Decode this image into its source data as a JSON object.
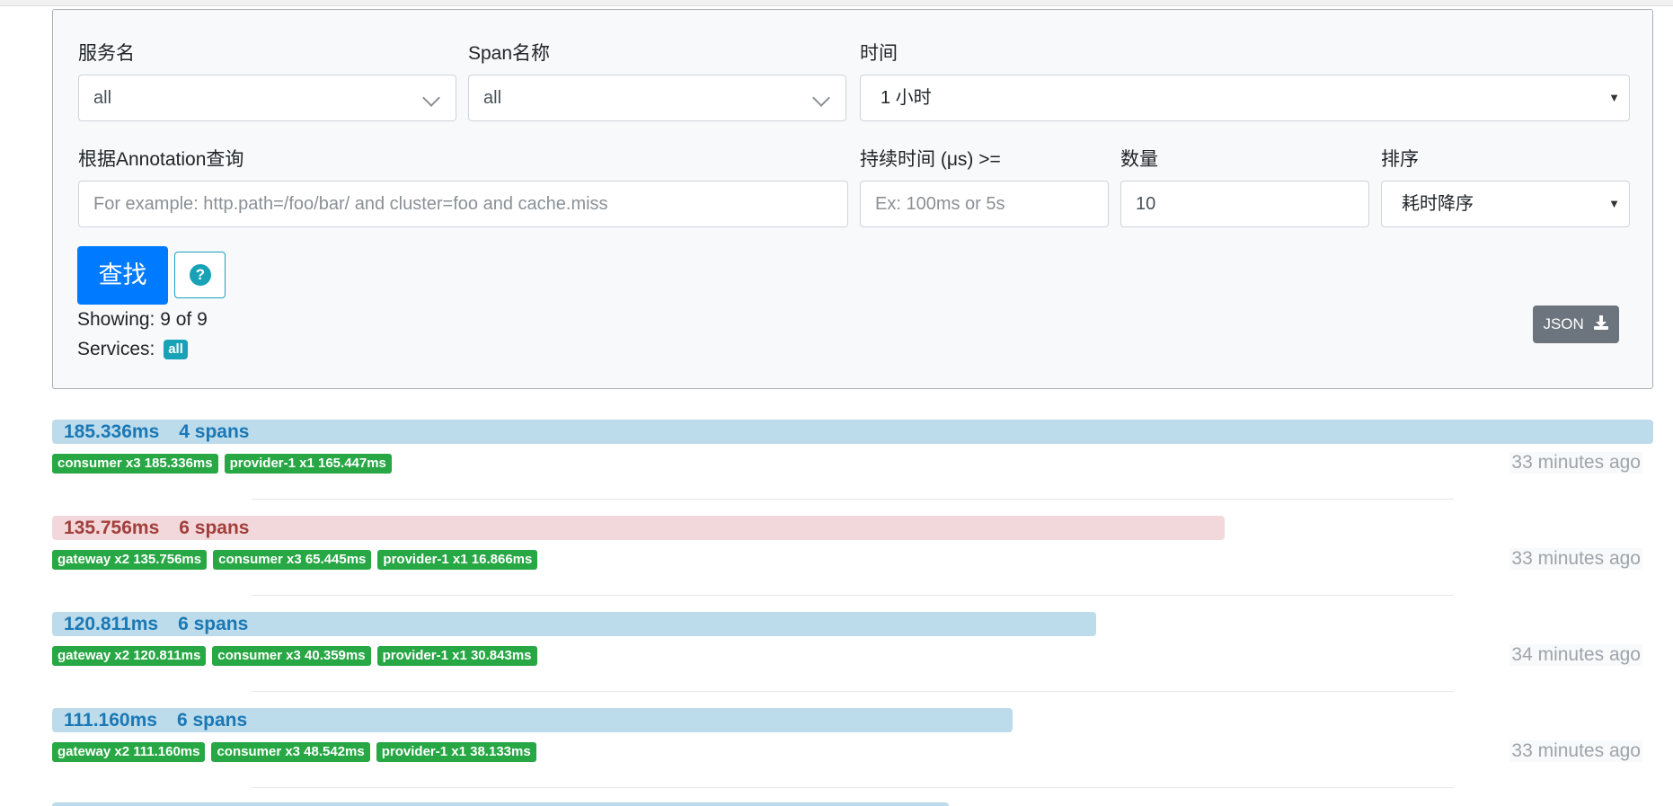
{
  "form": {
    "service_label": "服务名",
    "service_value": "all",
    "span_label": "Span名称",
    "span_value": "all",
    "time_label": "时间",
    "time_value": "1 小时",
    "annotation_label": "根据Annotation查询",
    "annotation_placeholder": "For example: http.path=/foo/bar/ and cluster=foo and cache.miss",
    "duration_label": "持续时间 (μs) >=",
    "duration_placeholder": "Ex: 100ms or 5s",
    "limit_label": "数量",
    "limit_value": "10",
    "sort_label": "排序",
    "sort_value": "耗时降序",
    "find_button": "查找",
    "help_icon": "question-circle-icon",
    "showing": "Showing: 9 of 9",
    "services_label": "Services:",
    "services_badge": "all",
    "json_button": "JSON",
    "json_icon": "download-icon"
  },
  "colors": {
    "primary": "#007bff",
    "info": "#17a2b8",
    "success": "#28a745",
    "bar_normal": "#bcdbeb",
    "bar_error": "#f2d8da",
    "secondary": "#6c757d"
  },
  "traces": [
    {
      "duration": "185.336ms",
      "spans": "4 spans",
      "width_fraction": 1.0,
      "status": "normal",
      "services": [
        "consumer x3 185.336ms",
        "provider-1 x1 165.447ms"
      ],
      "ago": "33 minutes ago"
    },
    {
      "duration": "135.756ms",
      "spans": "6 spans",
      "width_fraction": 0.7325,
      "status": "error",
      "services": [
        "gateway x2 135.756ms",
        "consumer x3 65.445ms",
        "provider-1 x1 16.866ms"
      ],
      "ago": "33 minutes ago"
    },
    {
      "duration": "120.811ms",
      "spans": "6 spans",
      "width_fraction": 0.6519,
      "status": "normal",
      "services": [
        "gateway x2 120.811ms",
        "consumer x3 40.359ms",
        "provider-1 x1 30.843ms"
      ],
      "ago": "34 minutes ago"
    },
    {
      "duration": "111.160ms",
      "spans": "6 spans",
      "width_fraction": 0.5998,
      "status": "normal",
      "services": [
        "gateway x2 111.160ms",
        "consumer x3 48.542ms",
        "provider-1 x1 38.133ms"
      ],
      "ago": "33 minutes ago"
    }
  ]
}
